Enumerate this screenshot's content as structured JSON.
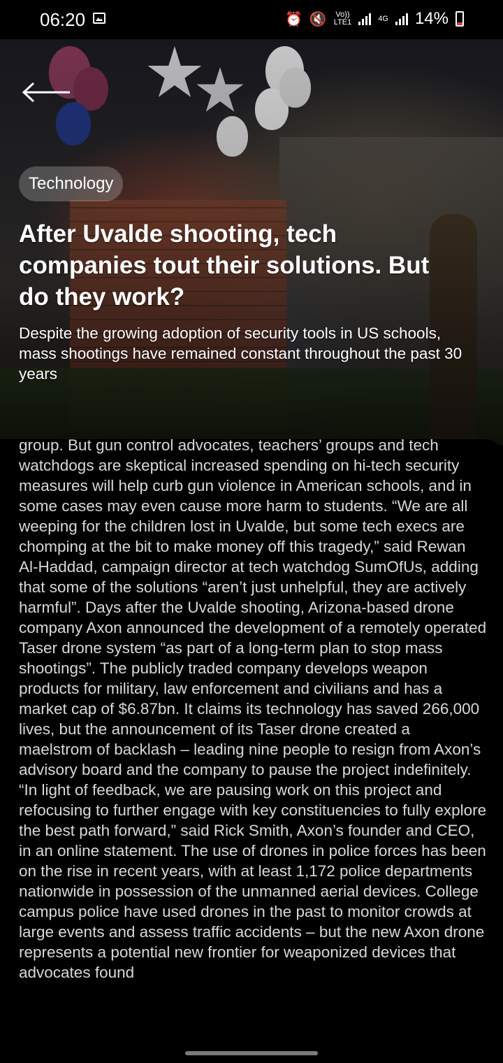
{
  "status_bar": {
    "time": "06:20",
    "network_volte": "Vo))",
    "network_lte": "LTE1",
    "network_gen": "4G",
    "battery_percent": "14%",
    "battery_level": 0.14,
    "icons": [
      "gallery-icon",
      "alarm-icon",
      "mute-icon",
      "signal-icon",
      "battery-icon"
    ]
  },
  "hero": {
    "back_icon": "back-arrow-icon",
    "category": "Technology",
    "title": "After Uvalde shooting, tech companies tout their solutions. But do they work?",
    "subtitle": "Despite the growing adoption of security tools in US schools, mass shootings have remained constant throughout the past 30 years"
  },
  "article": {
    "body": "group. But gun control advocates, teachers’ groups and tech watchdogs are skeptical increased spending on hi-tech security measures will help curb gun violence in American schools, and in some cases may even cause more harm to students. “We are all weeping for the children lost in Uvalde, but some tech execs are chomping at the bit to make money off this tragedy,” said Rewan Al-Haddad, campaign director at tech watchdog SumOfUs, adding that some of the solutions “aren’t just unhelpful, they are actively harmful”. Days after the Uvalde shooting, Arizona-based drone company Axon announced the development of a remotely operated Taser drone system “as part of a long-term plan to stop mass shootings”. The publicly traded company develops weapon products for military, law enforcement and civilians and has a market cap of $6.87bn. It claims its technology has saved 266,000 lives, but the announcement of its Taser drone created a maelstrom of backlash – leading nine people to resign from Axon’s advisory board and the company to pause the project indefinitely. “In light of feedback, we are pausing work on this project and refocusing to further engage with key constituencies to fully explore the best path forward,” said Rick Smith, Axon’s founder and CEO, in an online statement. The use of drones in police forces has been on the rise in recent years, with at least 1,172 police departments nationwide in possession of the unmanned aerial devices. College campus police have used drones in the past to monitor crowds at large events and assess traffic accidents – but the new Axon drone represents a potential new frontier for weaponized devices that advocates found"
  },
  "colors": {
    "background": "#000000",
    "text": "#d8d8d8",
    "battery_low": "#e53935"
  }
}
